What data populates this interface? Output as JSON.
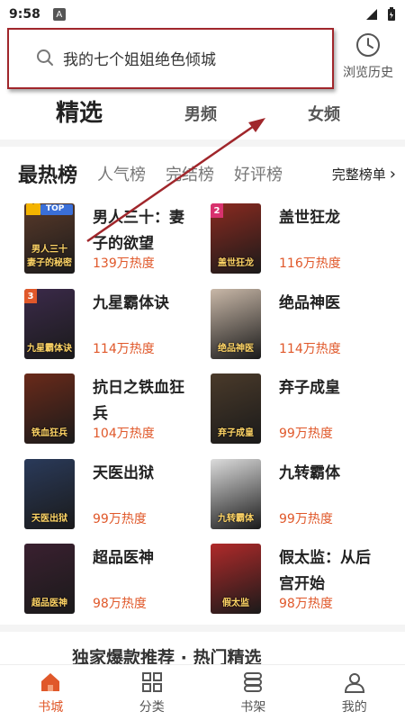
{
  "status_bar": {
    "time": "9:58",
    "indicator": "A"
  },
  "search": {
    "placeholder": "我的七个姐姐绝色倾城"
  },
  "history": {
    "label": "浏览历史"
  },
  "top_tabs": [
    {
      "label": "精选"
    },
    {
      "label": "男频"
    },
    {
      "label": "女频"
    }
  ],
  "rank_tabs": [
    {
      "label": "最热榜"
    },
    {
      "label": "人气榜"
    },
    {
      "label": "完结榜"
    },
    {
      "label": "好评榜"
    }
  ],
  "rank_full": {
    "label": "完整榜单",
    "chevron": "›"
  },
  "books": [
    {
      "rank": "TOP",
      "title": "男人三十：妻子的欲望",
      "heat": "139万热度",
      "cover_text": "男人三十 妻子的秘密",
      "color": "#5a3a2a"
    },
    {
      "rank": "2",
      "title": "盖世狂龙",
      "heat": "116万热度",
      "cover_text": "盖世狂龙",
      "color": "#8a2a20"
    },
    {
      "rank": "3",
      "title": "九星霸体诀",
      "heat": "114万热度",
      "cover_text": "九星霸体诀",
      "color": "#3b2a4a"
    },
    {
      "rank": "",
      "title": "绝品神医",
      "heat": "114万热度",
      "cover_text": "绝品神医",
      "color": "#c9b8a8"
    },
    {
      "rank": "",
      "title": "抗日之铁血狂兵",
      "heat": "104万热度",
      "cover_text": "铁血狂兵",
      "color": "#6a2a1a"
    },
    {
      "rank": "",
      "title": "弃子成皇",
      "heat": "99万热度",
      "cover_text": "弃子成皇",
      "color": "#4a3a2a"
    },
    {
      "rank": "",
      "title": "天医出狱",
      "heat": "99万热度",
      "cover_text": "天医出狱",
      "color": "#2a3a5a"
    },
    {
      "rank": "",
      "title": "九转霸体",
      "heat": "99万热度",
      "cover_text": "九转霸体",
      "color": "#dcdcdc"
    },
    {
      "rank": "",
      "title": "超品医神",
      "heat": "98万热度",
      "cover_text": "超品医神",
      "color": "#3a2030"
    },
    {
      "rank": "",
      "title": "假太监：从后宫开始",
      "heat": "98万热度",
      "cover_text": "假太监",
      "color": "#b02a2a"
    }
  ],
  "section_partial": "独家爆款推荐 · 热门精选",
  "bottom_nav": [
    {
      "label": "书城",
      "icon": "home-icon"
    },
    {
      "label": "分类",
      "icon": "grid-icon"
    },
    {
      "label": "书架",
      "icon": "bookshelf-icon"
    },
    {
      "label": "我的",
      "icon": "profile-icon"
    }
  ],
  "colors": {
    "accent": "#e0582a",
    "annotation": "#a0262b"
  }
}
